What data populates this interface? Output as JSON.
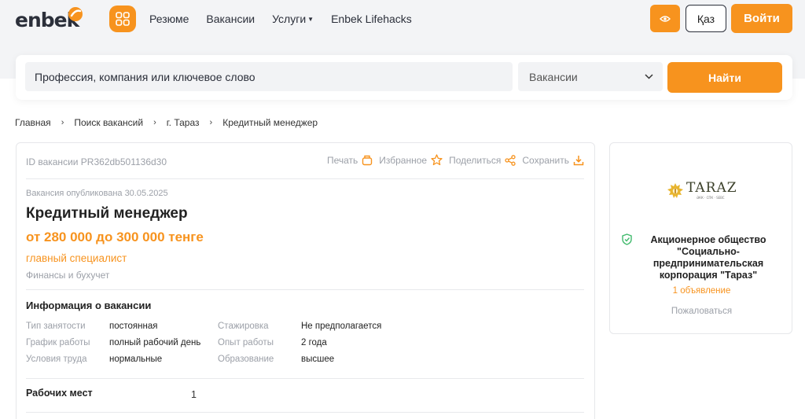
{
  "header": {
    "logo_text": "enbek",
    "nav": [
      {
        "label": "Резюме"
      },
      {
        "label": "Вакансии"
      },
      {
        "label": "Услуги"
      },
      {
        "label": "Enbek Lifehacks"
      }
    ],
    "lang_label": "Қаз",
    "login_label": "Войти"
  },
  "search": {
    "placeholder": "Профессия, компания или ключевое слово",
    "type_value": "Вакансии",
    "button_label": "Найти"
  },
  "breadcrumb": [
    "Главная",
    "Поиск вакансий",
    "г. Тараз",
    "Кредитный менеджер"
  ],
  "vacancy": {
    "id_text": "ID вакансии PR362db501136d30",
    "actions": {
      "print": "Печать",
      "favorite": "Избранное",
      "share": "Поделиться",
      "save": "Сохранить"
    },
    "published": "Вакансия опубликована 30.05.2025",
    "title": "Кредитный менеджер",
    "salary": "от 280 000 до 300 000 тенге",
    "position": "главный специалист",
    "category": "Финансы и бухучет",
    "info_title": "Информация о вакансии",
    "info": {
      "employment_type_label": "Тип занятости",
      "employment_type": "постоянная",
      "internship_label": "Стажировка",
      "internship": "Не предполагается",
      "schedule_label": "График работы",
      "schedule": "полный рабочий день",
      "experience_label": "Опыт работы",
      "experience": "2 года",
      "conditions_label": "Условия труда",
      "conditions": "нормальные",
      "education_label": "Образование",
      "education": "высшее"
    },
    "seats_label": "Рабочих мест",
    "seats": "1"
  },
  "company": {
    "logo_text": "TARAZ",
    "logo_subtext": "ӘКК · СПК · SEBC",
    "name": "Акционерное общество \"Социально-предпринимательская корпорация \"Тараз\"",
    "ads": "1 объявление",
    "complain": "Пожаловаться"
  },
  "colors": {
    "accent": "#f7931e",
    "text": "#222222",
    "muted": "#9ca0a8",
    "shield": "#3fb96b"
  },
  "icons": [
    "apps-grid-icon",
    "chevron-down-icon",
    "eye-icon",
    "printer-icon",
    "star-icon",
    "share-icon",
    "download-icon",
    "shield-check-icon"
  ]
}
